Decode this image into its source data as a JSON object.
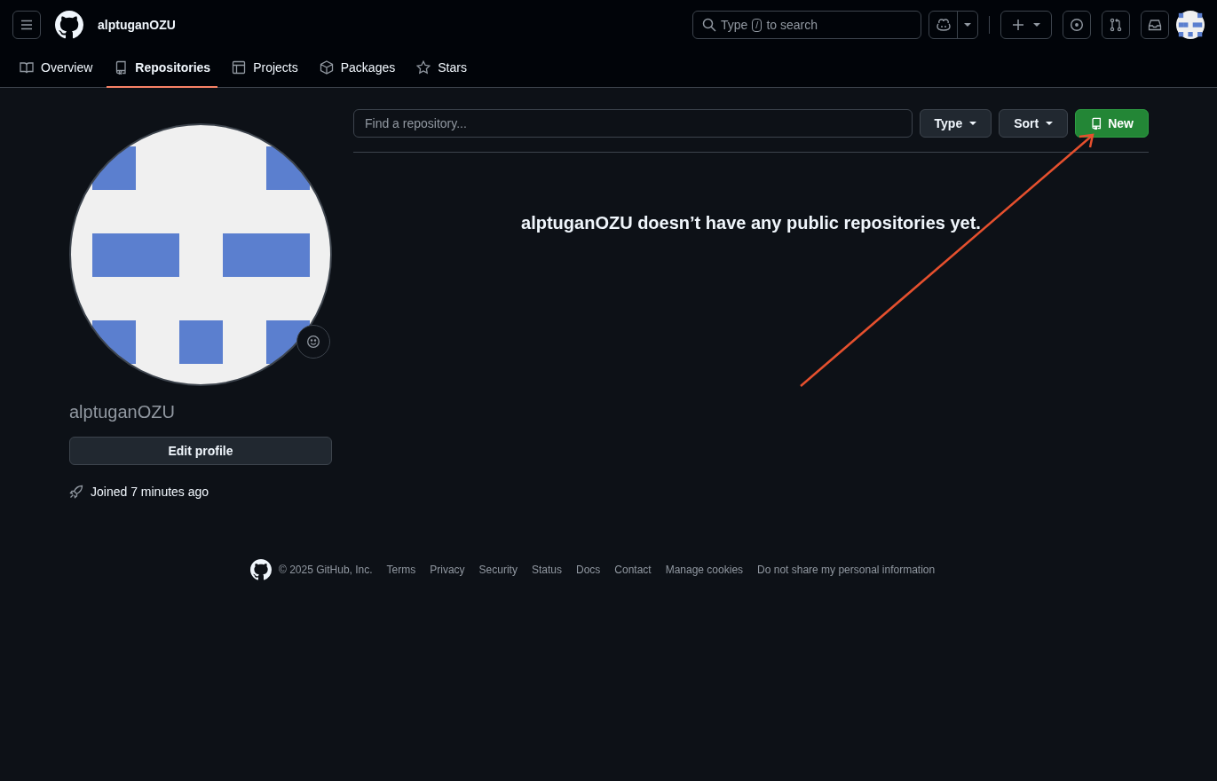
{
  "header": {
    "username": "alptuganOZU",
    "search": {
      "placeholder_before": "Type",
      "key": "/",
      "placeholder_after": "to search"
    }
  },
  "tabs": [
    {
      "label": "Overview",
      "selected": false
    },
    {
      "label": "Repositories",
      "selected": true
    },
    {
      "label": "Projects",
      "selected": false
    },
    {
      "label": "Packages",
      "selected": false
    },
    {
      "label": "Stars",
      "selected": false
    }
  ],
  "profile": {
    "username": "alptuganOZU",
    "edit_button": "Edit profile",
    "joined": "Joined 7 minutes ago"
  },
  "repositories": {
    "search": {
      "placeholder": "Find a repository..."
    },
    "filters": [
      "Type",
      "Sort"
    ],
    "new_button": "New",
    "empty_message": "alptuganOZU doesn’t have any public repositories yet."
  },
  "footer": {
    "copyright": "© 2025 GitHub, Inc.",
    "links": [
      "Terms",
      "Privacy",
      "Security",
      "Status",
      "Docs",
      "Contact",
      "Manage cookies",
      "Do not share my personal information"
    ]
  }
}
